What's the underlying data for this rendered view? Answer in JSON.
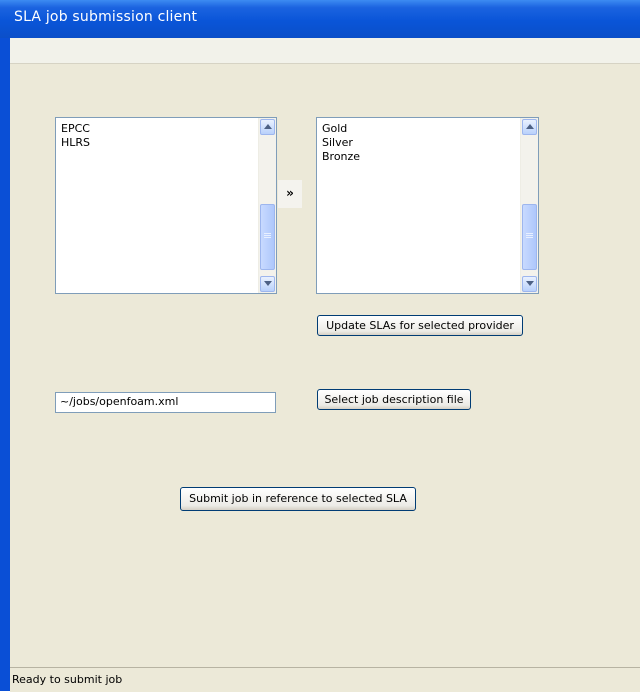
{
  "window": {
    "title": "SLA job submission client"
  },
  "providers": {
    "items": [
      "EPCC",
      "HLRS"
    ]
  },
  "transfer_button": {
    "label": "»"
  },
  "slas": {
    "items": [
      "Gold",
      "Silver",
      "Bronze"
    ]
  },
  "update_button": {
    "label": "Update SLAs for selected provider"
  },
  "job_file": {
    "value": "~/jobs/openfoam.xml"
  },
  "select_file_button": {
    "label": "Select job description file"
  },
  "submit_button": {
    "label": "Submit job in reference to selected SLA"
  },
  "status": {
    "text": "Ready to submit job"
  },
  "colors": {
    "titlebar": "#0a55d8",
    "frame": "#0a4fd6",
    "background": "#ece9d8",
    "scrollbar": "#b9d1fb"
  }
}
